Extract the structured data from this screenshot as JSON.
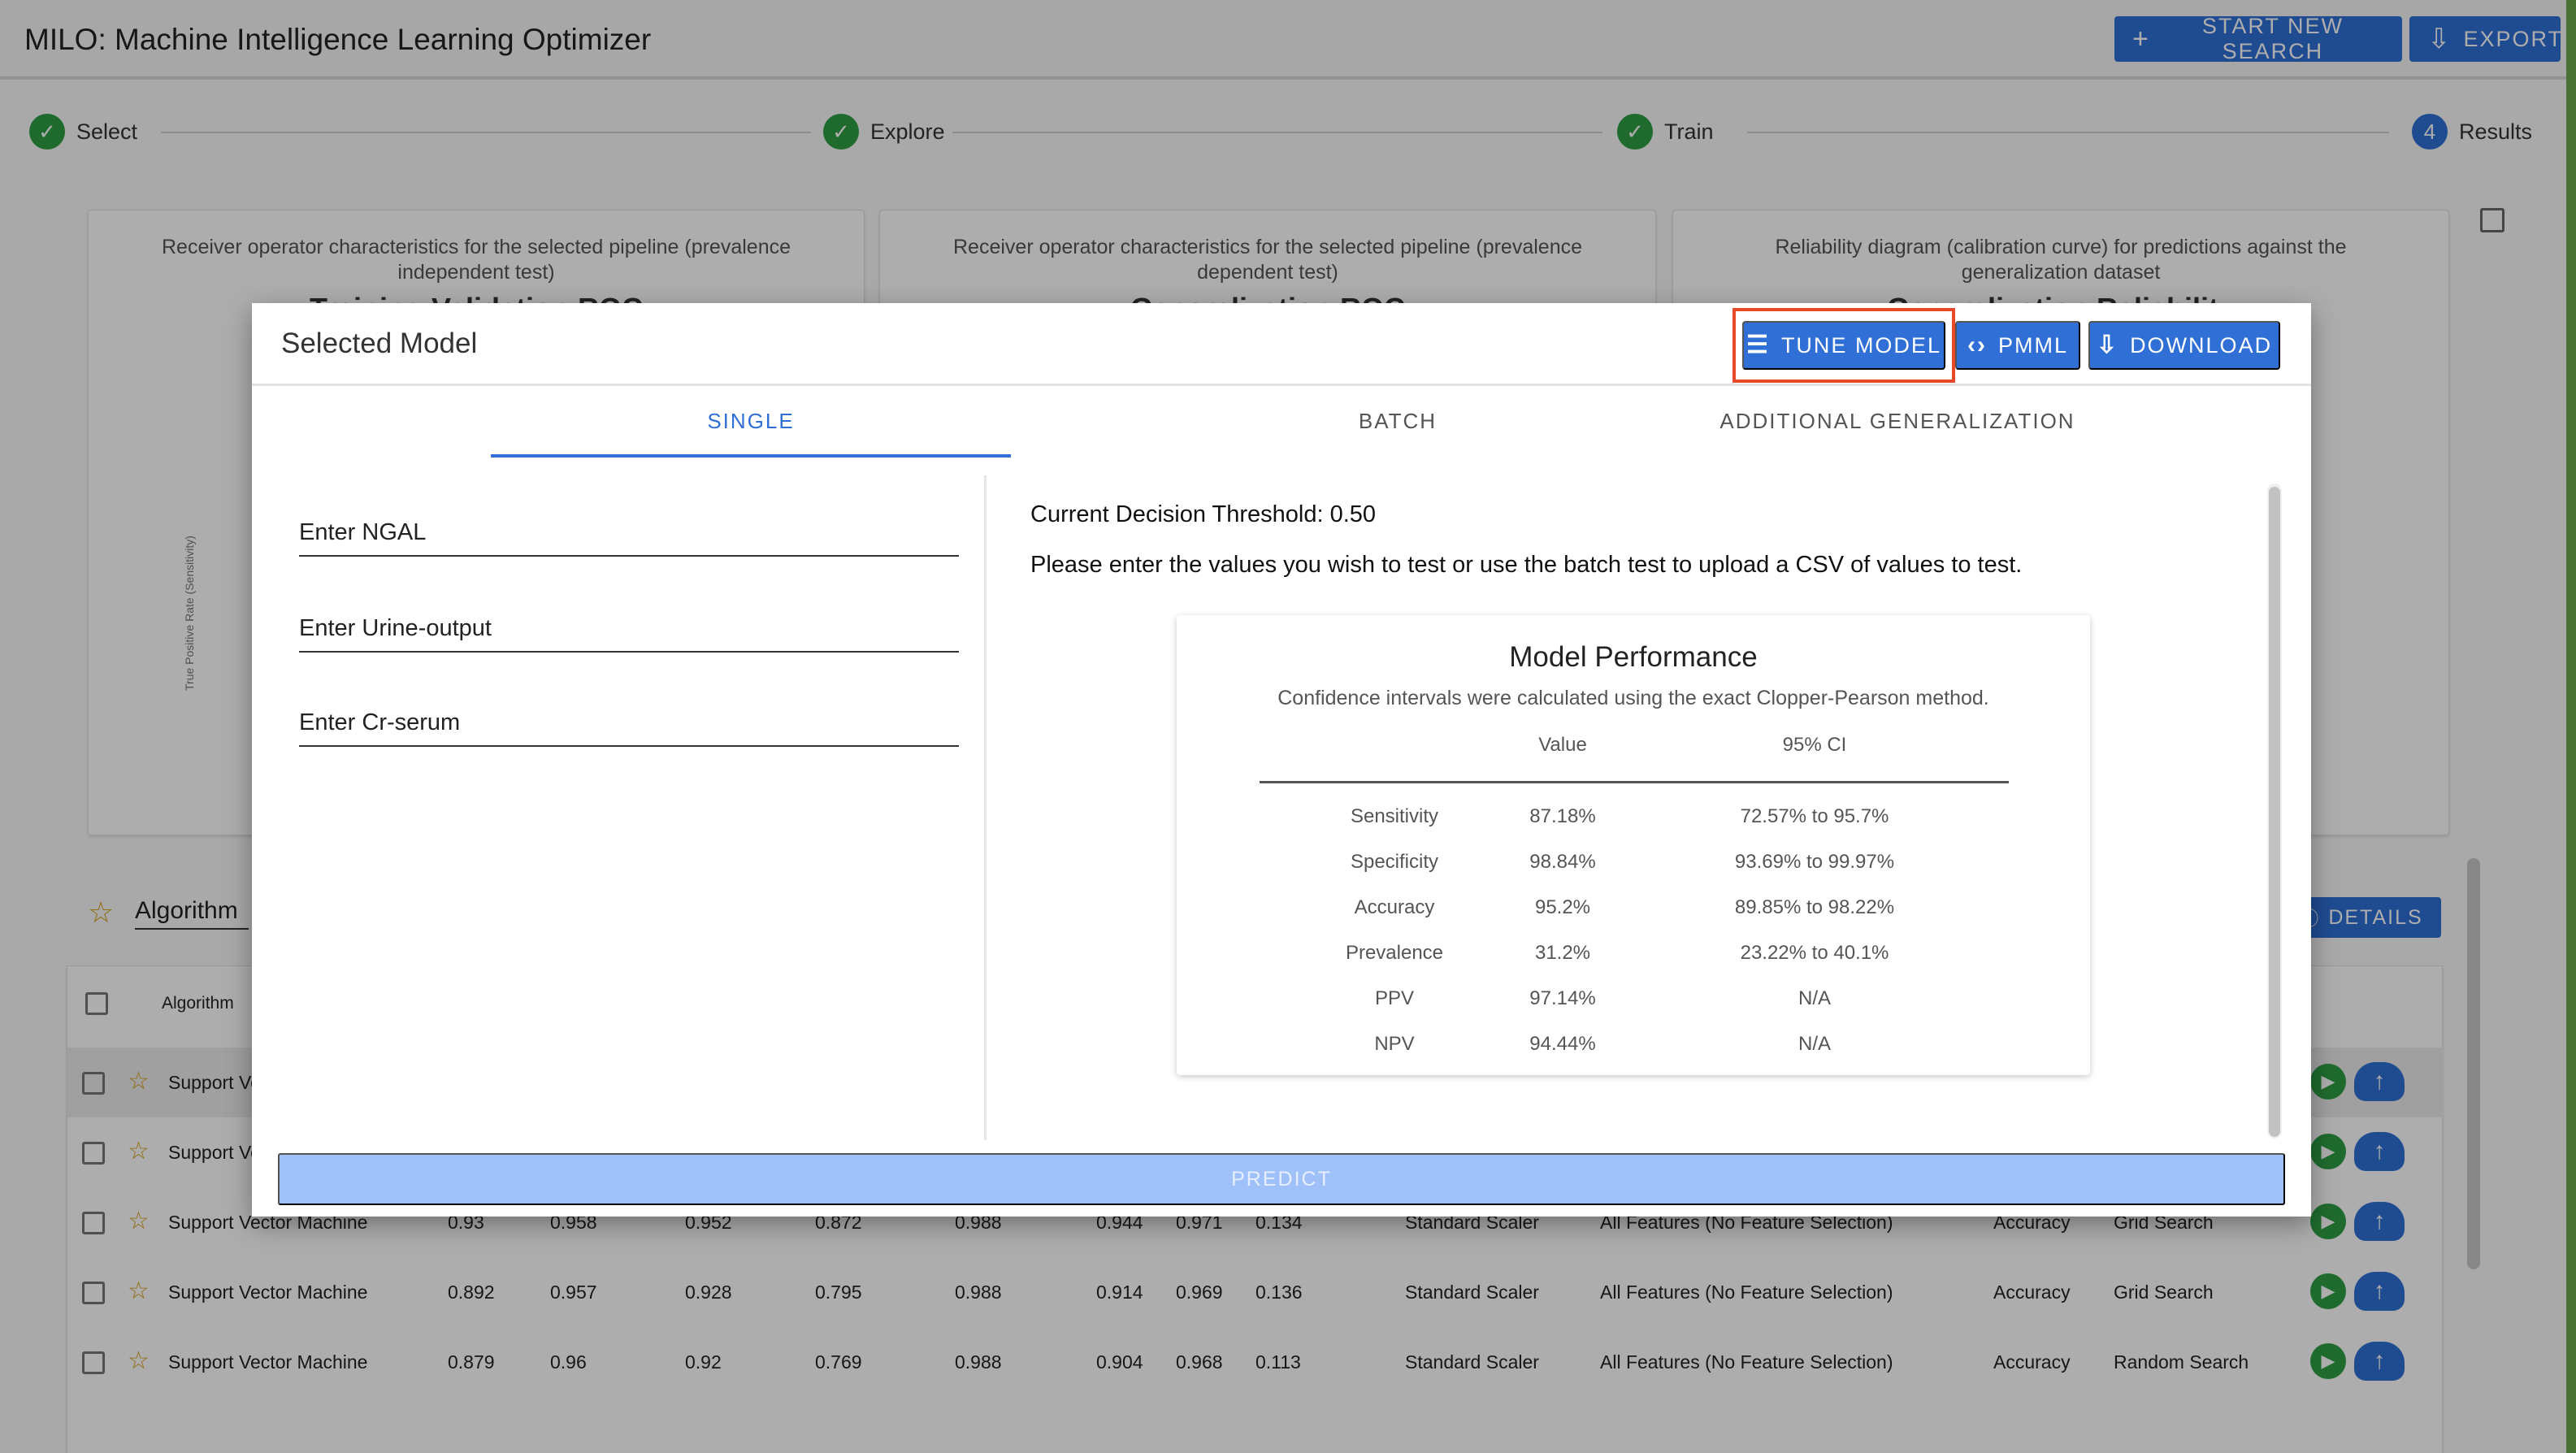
{
  "app": {
    "title": "MILO: Machine Intelligence Learning Optimizer",
    "start_new_search": "START NEW SEARCH",
    "export": "EXPORT"
  },
  "stepper": {
    "steps": [
      {
        "label": "Select",
        "icon": "check-icon"
      },
      {
        "label": "Explore",
        "icon": "check-icon"
      },
      {
        "label": "Train",
        "icon": "check-icon"
      },
      {
        "label": "Results",
        "number": "4"
      }
    ]
  },
  "cards": [
    {
      "caption": "Receiver operator characteristics for the selected pipeline (prevalence independent test)",
      "heading": "Training Validation ROC"
    },
    {
      "caption": "Receiver operator characteristics for the selected pipeline (prevalence dependent test)",
      "heading": "Generalization ROC"
    },
    {
      "caption": "Reliability diagram (calibration curve) for predictions against the generalization dataset",
      "heading": "Generalization Reliability"
    }
  ],
  "y_axis_label": "True Positive Rate (Sensitivity)",
  "algorithm_filter": {
    "label": "Algorithm",
    "details": "DETAILS"
  },
  "table": {
    "header_algorithm": "Algorithm",
    "rows": [
      {
        "algorithm": "Support Vector Machine",
        "c1": "",
        "c2": "",
        "c3": "",
        "c4": "",
        "c5": "",
        "c6": "",
        "c7": "",
        "c8": "",
        "scaler": "",
        "features": "",
        "metric": "",
        "search": "",
        "highlighted": true
      },
      {
        "algorithm": "Support Vector Machine",
        "c1": "",
        "c2": "",
        "c3": "",
        "c4": "",
        "c5": "",
        "c6": "",
        "c7": "",
        "c8": "",
        "scaler": "",
        "features": "",
        "metric": "",
        "search": "",
        "highlighted": false
      },
      {
        "algorithm": "Support Vector Machine",
        "c1": "0.93",
        "c2": "0.958",
        "c3": "0.952",
        "c4": "0.872",
        "c5": "0.988",
        "c6": "0.944",
        "c7": "0.971",
        "c8": "0.134",
        "scaler": "Standard Scaler",
        "features": "All Features (No Feature Selection)",
        "metric": "Accuracy",
        "search": "Grid Search",
        "highlighted": false
      },
      {
        "algorithm": "Support Vector Machine",
        "c1": "0.892",
        "c2": "0.957",
        "c3": "0.928",
        "c4": "0.795",
        "c5": "0.988",
        "c6": "0.914",
        "c7": "0.969",
        "c8": "0.136",
        "scaler": "Standard Scaler",
        "features": "All Features (No Feature Selection)",
        "metric": "Accuracy",
        "search": "Grid Search",
        "highlighted": false
      },
      {
        "algorithm": "Support Vector Machine",
        "c1": "0.879",
        "c2": "0.96",
        "c3": "0.92",
        "c4": "0.769",
        "c5": "0.988",
        "c6": "0.904",
        "c7": "0.968",
        "c8": "0.113",
        "scaler": "Standard Scaler",
        "features": "All Features (No Feature Selection)",
        "metric": "Accuracy",
        "search": "Random Search",
        "highlighted": false
      }
    ]
  },
  "modal": {
    "title": "Selected Model",
    "tune_model": "TUNE MODEL",
    "pmml": "PMML",
    "download": "DOWNLOAD",
    "tabs": [
      "SINGLE",
      "BATCH",
      "ADDITIONAL GENERALIZATION"
    ],
    "active_tab": "SINGLE",
    "fields": [
      {
        "label": "Enter NGAL",
        "value": ""
      },
      {
        "label": "Enter Urine-output",
        "value": ""
      },
      {
        "label": "Enter Cr-serum",
        "value": ""
      }
    ],
    "threshold": "Current Decision Threshold: 0.50",
    "instructions": "Please enter the values you wish to test or use the batch test to upload a CSV of values to test.",
    "performance": {
      "title": "Model Performance",
      "subtitle": "Confidence intervals were calculated using the exact Clopper-Pearson method.",
      "col_value": "Value",
      "col_ci": "95% CI",
      "rows": [
        {
          "metric": "Sensitivity",
          "value": "87.18%",
          "ci": "72.57% to 95.7%"
        },
        {
          "metric": "Specificity",
          "value": "98.84%",
          "ci": "93.69% to 99.97%"
        },
        {
          "metric": "Accuracy",
          "value": "95.2%",
          "ci": "89.85% to 98.22%"
        },
        {
          "metric": "Prevalence",
          "value": "31.2%",
          "ci": "23.22% to 40.1%"
        },
        {
          "metric": "PPV",
          "value": "97.14%",
          "ci": "N/A"
        },
        {
          "metric": "NPV",
          "value": "94.44%",
          "ci": "N/A"
        }
      ]
    },
    "predict": "PREDICT"
  },
  "colors": {
    "primary": "#2f6fd6",
    "success": "#2e9e45",
    "highlight_box": "#e8492a",
    "predict_disabled": "#9fc0f8"
  }
}
